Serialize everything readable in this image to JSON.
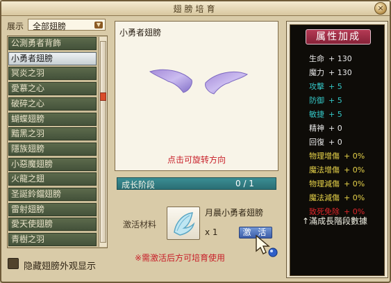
{
  "window": {
    "title": "翅膀培育",
    "close_label": "×"
  },
  "filter": {
    "label": "展示",
    "value": "全部翅膀",
    "chevron": "▼"
  },
  "wing_list": [
    "公測勇者背飾",
    "小勇者翅膀",
    "冥炎之羽",
    "愛慕之心",
    "破碎之心",
    "蝴蝶翅膀",
    "黯黑之羽",
    "隱族翅膀",
    "小惡魔翅膀",
    "火龍之翅",
    "圣誕鈴鐺翅膀",
    "雷射翅膀",
    "愛天使翅膀",
    "青樹之羽"
  ],
  "selected_index": 1,
  "hide_toggle": {
    "label": "隐藏翅膀外观显示",
    "checked": false
  },
  "preview": {
    "name": "小勇者翅膀",
    "hint": "点击可旋转方向"
  },
  "growth": {
    "label": "成长阶段",
    "value": "0 / 1"
  },
  "material": {
    "label": "激活材料",
    "name": "月晨小勇者翅膀",
    "qty": "x 1",
    "activate_label": "激 活"
  },
  "note": "※需激活后方可培育使用",
  "attributes": {
    "title": "属性加成",
    "rows": [
      {
        "k": "生命",
        "v": "+ 130",
        "color": "#e8e8e8"
      },
      {
        "k": "魔力",
        "v": "+ 130",
        "color": "#e8e8e8"
      },
      {
        "k": "攻擊",
        "v": "+ 5",
        "color": "#34c6c6"
      },
      {
        "k": "防御",
        "v": "+ 5",
        "color": "#34c6c6"
      },
      {
        "k": "敏捷",
        "v": "+ 5",
        "color": "#34c6c6"
      },
      {
        "k": "精神",
        "v": "+ 0",
        "color": "#e8e8e8"
      },
      {
        "k": "回復",
        "v": "+ 0",
        "color": "#e8e8e8"
      },
      {
        "k": "物理增傷",
        "v": "+ 0%",
        "color": "#e9d54a"
      },
      {
        "k": "魔法增傷",
        "v": "+ 0%",
        "color": "#e9d54a"
      },
      {
        "k": "物理減傷",
        "v": "+ 0%",
        "color": "#e9d54a"
      },
      {
        "k": "魔法減傷",
        "v": "+ 0%",
        "color": "#e9d54a"
      },
      {
        "k": "致死免除",
        "v": "+ 0%",
        "color": "#e0262a"
      }
    ],
    "footnote": "↑滿成長階段數據"
  }
}
